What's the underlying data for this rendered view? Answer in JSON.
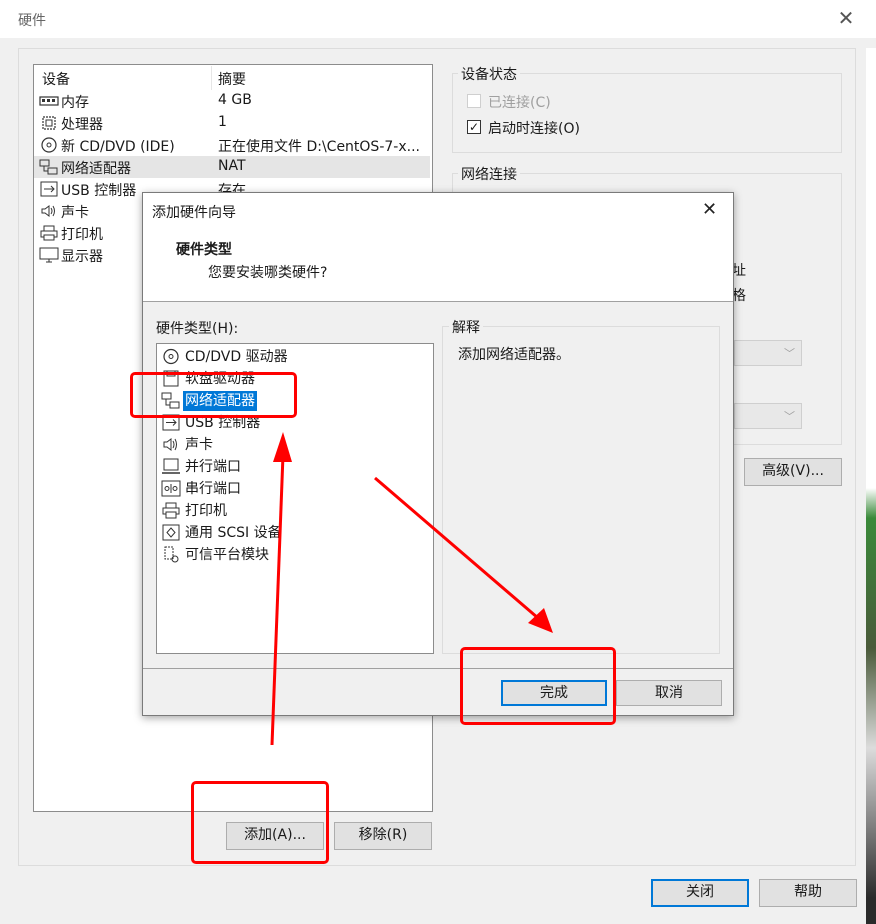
{
  "window": {
    "title": "硬件",
    "close_glyph": "✕",
    "close_label": "关闭",
    "help_label": "帮助"
  },
  "device_list": {
    "col_device": "设备",
    "col_summary": "摘要",
    "rows": [
      {
        "icon": "memory-icon",
        "name": "内存",
        "summary": "4 GB"
      },
      {
        "icon": "processor-icon",
        "name": "处理器",
        "summary": "1"
      },
      {
        "icon": "cd-dvd-icon",
        "name": "新 CD/DVD (IDE)",
        "summary": "正在使用文件 D:\\CentOS-7-x..."
      },
      {
        "icon": "network-adapter-icon",
        "name": "网络适配器",
        "summary": "NAT"
      },
      {
        "icon": "usb-icon",
        "name": "USB 控制器",
        "summary": "存在"
      },
      {
        "icon": "sound-icon",
        "name": "声卡",
        "summary": ""
      },
      {
        "icon": "printer-icon",
        "name": "打印机",
        "summary": ""
      },
      {
        "icon": "display-icon",
        "name": "显示器",
        "summary": ""
      }
    ],
    "add_label": "添加(A)...",
    "remove_label": "移除(R)"
  },
  "device_status": {
    "title": "设备状态",
    "connected_label": "已连接(C)",
    "connected_checked": false,
    "connect_on_start_label": "启动时连接(O)",
    "connect_on_start_checked": true,
    "check_glyph": "✓"
  },
  "network_connection": {
    "title": "网络连接",
    "partial_text_1": "址",
    "partial_text_2": "格",
    "advanced_label": "高级(V)..."
  },
  "dialog": {
    "title": "添加硬件向导",
    "close_glyph": "✕",
    "header_title": "硬件类型",
    "header_subtitle": "您要安装哪类硬件?",
    "hw_type_label": "硬件类型(H):",
    "hardware_types": [
      {
        "icon": "cd-dvd-icon",
        "label": "CD/DVD 驱动器"
      },
      {
        "icon": "floppy-icon",
        "label": "软盘驱动器"
      },
      {
        "icon": "network-adapter-icon",
        "label": "网络适配器",
        "selected": true
      },
      {
        "icon": "usb-icon",
        "label": "USB 控制器"
      },
      {
        "icon": "sound-icon",
        "label": "声卡"
      },
      {
        "icon": "parallel-port-icon",
        "label": "并行端口"
      },
      {
        "icon": "serial-port-icon",
        "label": "串行端口"
      },
      {
        "icon": "printer-icon",
        "label": "打印机"
      },
      {
        "icon": "scsi-icon",
        "label": "通用 SCSI 设备"
      },
      {
        "icon": "tpm-icon",
        "label": "可信平台模块"
      }
    ],
    "explain_title": "解释",
    "explain_text": "添加网络适配器。",
    "finish_label": "完成",
    "cancel_label": "取消"
  },
  "colors": {
    "annotation_red": "#ff0000",
    "selection_blue": "#0078d7"
  }
}
